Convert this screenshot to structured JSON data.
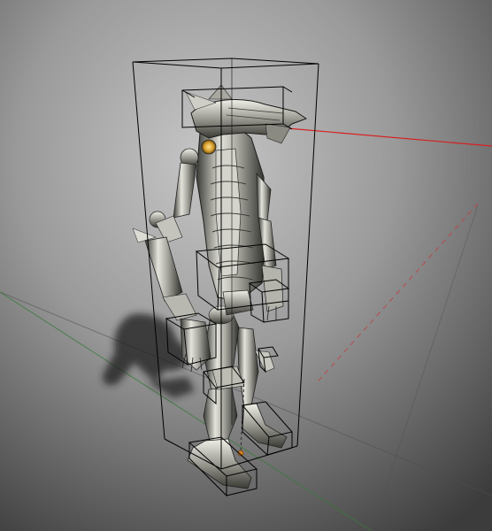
{
  "viewport": {
    "kind": "3d-modeling-viewport",
    "view": "perspective",
    "has_text": false
  },
  "scene": {
    "model": "robot",
    "bounding_boxes": true,
    "ground_shadow": true,
    "sight_line": true,
    "pivot_marker": true
  },
  "colors": {
    "background_top": "#b8b8b8",
    "background_bottom": "#3d3d3d",
    "ground_grid_line": "#4a4a4a",
    "x_axis": "#c04040",
    "y_axis": "#3a7a3a",
    "sight_line": "#d62020",
    "wireframe": "#000000",
    "metal_light": "#d8d8d0",
    "metal_mid": "#9a9a92",
    "metal_dark": "#2a2a26",
    "eye_glow": "#d8a030",
    "pivot": "#d08020"
  }
}
